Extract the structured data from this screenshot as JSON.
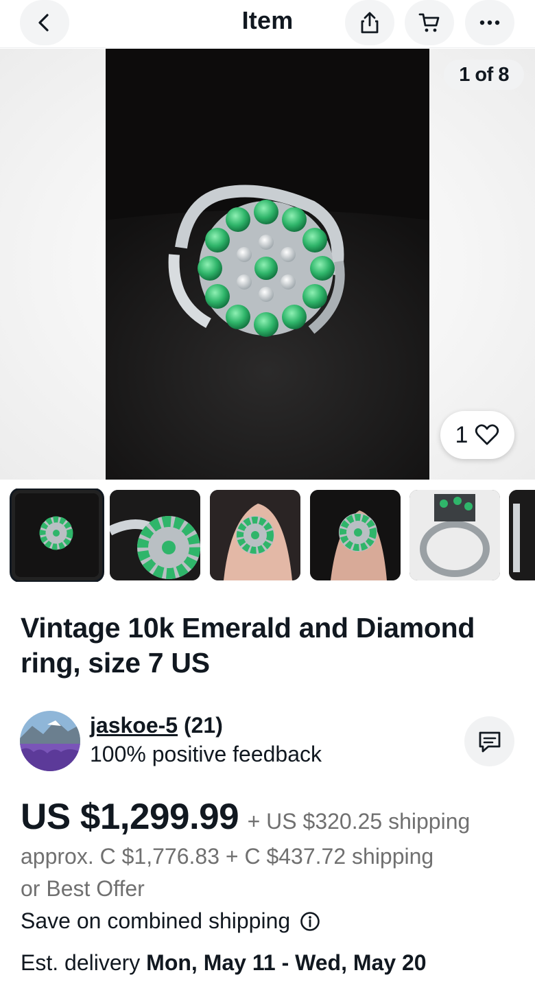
{
  "header": {
    "title": "Item",
    "back_icon": "chevron-left-icon",
    "share_icon": "share-icon",
    "cart_icon": "cart-icon",
    "more_icon": "more-icon"
  },
  "gallery": {
    "counter": "1 of 8",
    "watch_count": "1",
    "selected_index": 1,
    "total": 8
  },
  "listing": {
    "title": "Vintage 10k Emerald and Diamond ring, size 7 US"
  },
  "seller": {
    "name": "jaskoe-5",
    "score": "(21)",
    "feedback": "100% positive feedback"
  },
  "price": {
    "main": "US $1,299.99",
    "shipping": "+ US $320.25 shipping",
    "approx": "approx. C $1,776.83 + C $437.72 shipping",
    "best_offer": "or Best Offer",
    "combined_shipping": "Save on combined shipping"
  },
  "delivery": {
    "label": "Est. delivery",
    "dates": "Mon, May 11 - Wed, May 20"
  },
  "colors": {
    "text": "#111820",
    "muted": "#707070",
    "emerald": "#2fb56a"
  }
}
